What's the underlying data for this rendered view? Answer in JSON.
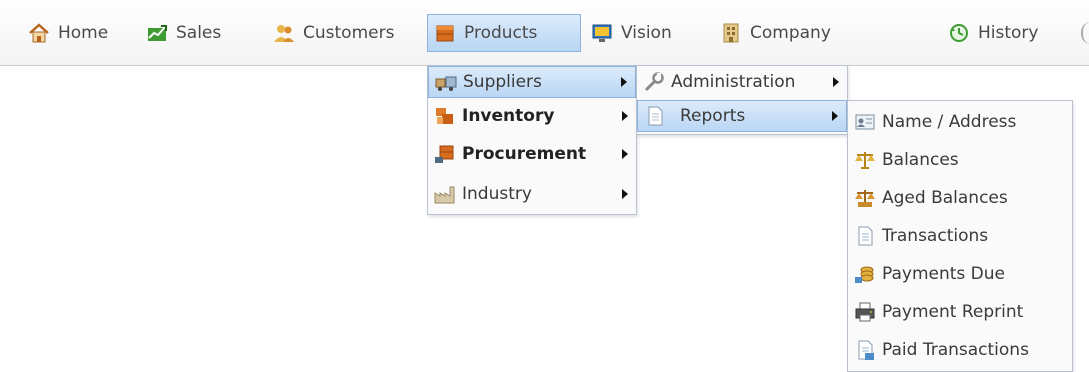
{
  "menubar": {
    "items": [
      {
        "label": "Home",
        "icon": "house-icon"
      },
      {
        "label": "Sales",
        "icon": "sales-chart-icon"
      },
      {
        "label": "Customers",
        "icon": "people-icon"
      },
      {
        "label": "Products",
        "icon": "products-box-icon",
        "active": true
      },
      {
        "label": "Vision",
        "icon": "monitor-icon"
      },
      {
        "label": "Company",
        "icon": "building-icon"
      },
      {
        "label": "History",
        "icon": "history-icon"
      }
    ]
  },
  "products_menu": {
    "items": [
      {
        "label": "Suppliers",
        "icon": "suppliers-icon",
        "submenu": true,
        "highlighted": true
      },
      {
        "label": "Inventory",
        "icon": "inventory-icon",
        "submenu": true,
        "bold": true
      },
      {
        "label": "Procurement",
        "icon": "procurement-icon",
        "submenu": true,
        "bold": true
      },
      {
        "label": "Industry",
        "icon": "industry-icon",
        "submenu": true
      }
    ]
  },
  "suppliers_menu": {
    "items": [
      {
        "label": "Administration",
        "icon": "wrench-icon",
        "submenu": true
      },
      {
        "label": "Reports",
        "icon": "report-page-icon",
        "submenu": true,
        "highlighted": true
      }
    ]
  },
  "reports_menu": {
    "items": [
      {
        "label": "Name / Address",
        "icon": "address-card-icon"
      },
      {
        "label": "Balances",
        "icon": "scales-icon"
      },
      {
        "label": "Aged Balances",
        "icon": "aged-scales-icon"
      },
      {
        "label": "Transactions",
        "icon": "document-icon"
      },
      {
        "label": "Payments Due",
        "icon": "payments-due-icon"
      },
      {
        "label": "Payment Reprint",
        "icon": "printer-icon"
      },
      {
        "label": "Paid Transactions",
        "icon": "paid-document-icon"
      }
    ]
  },
  "colors": {
    "highlight_top": "#dcebfb",
    "highlight_bottom": "#b9d6f4",
    "highlight_border": "#8db2dd"
  }
}
